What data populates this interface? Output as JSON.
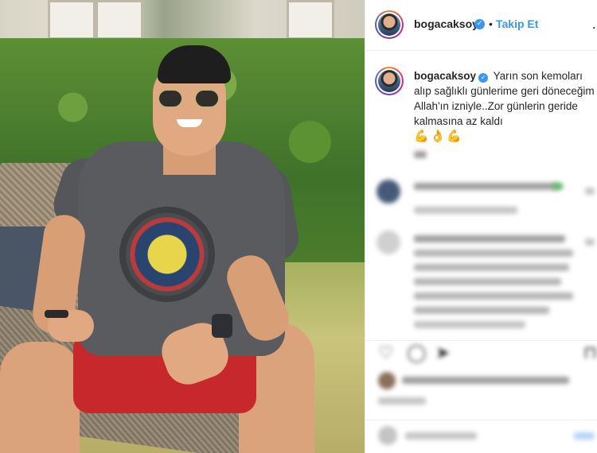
{
  "post": {
    "username": "bogacaksoy",
    "verified_glyph": "✓",
    "separator": "•",
    "follow_label": "Takip Et",
    "more_glyph": "…",
    "caption_text": "Yarın son kemoları alıp sağlıklı günlerime geri döneceğim Allah'ın izniyle..Zor günlerin geride kalmasına az kaldı",
    "caption_emojis": "💪👌💪"
  },
  "actions": {
    "like_glyph": "♡",
    "comment_glyph": "◯",
    "share_glyph": "➤",
    "save_glyph": "⊓"
  }
}
